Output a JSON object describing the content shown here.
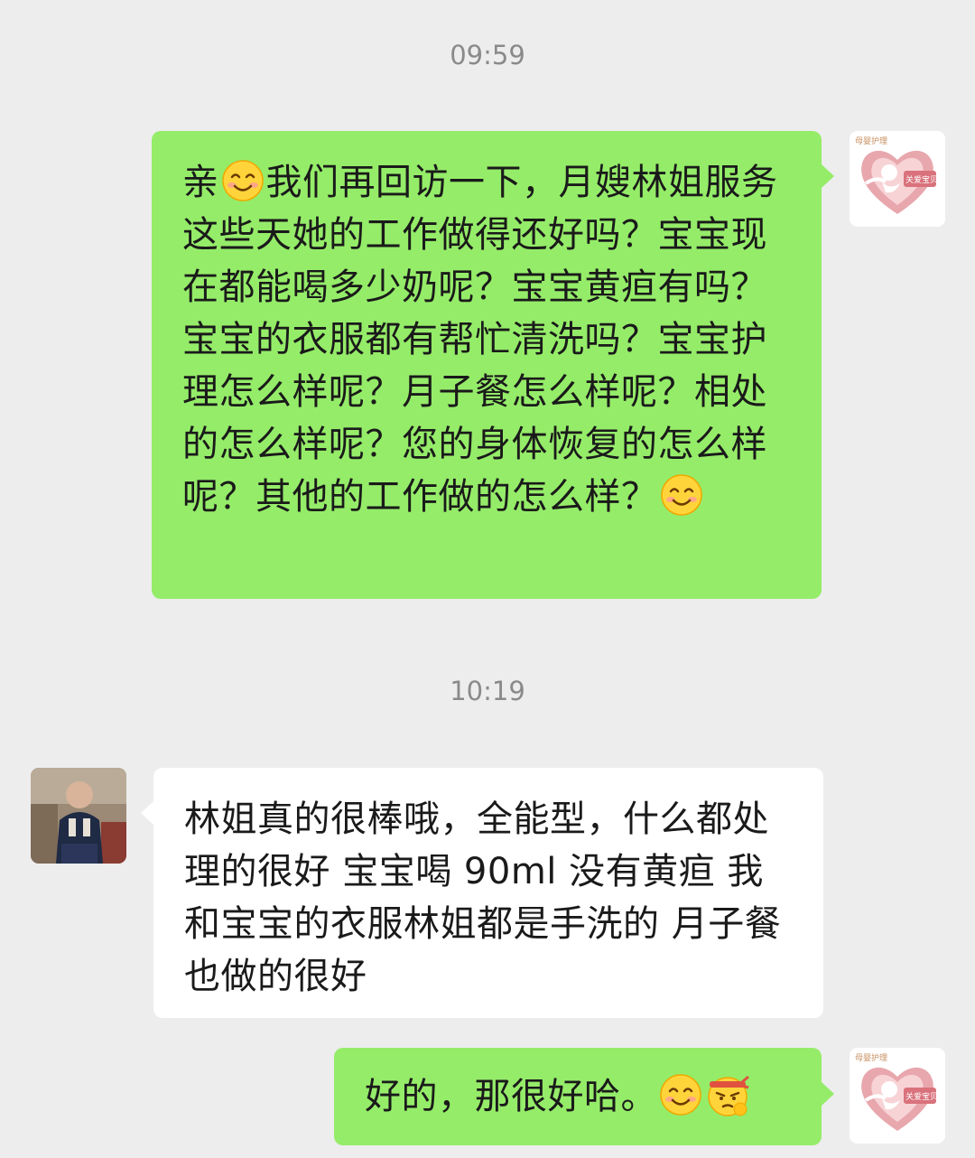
{
  "chat": {
    "timestamp_1": "09:59",
    "timestamp_2": "10:19",
    "msg1": {
      "part1": "亲",
      "part2": "我们再回访一下，月嫂林姐服务这些天她的工作做得还好吗？宝宝现在都能喝多少奶呢？宝宝黄疸有吗？宝宝的衣服都有帮忙清洗吗？宝宝护理怎么样呢？月子餐怎么样呢？相处的怎么样呢？您的身体恢复的怎么样呢？其他的工作做的怎么样？"
    },
    "msg2": {
      "text": "林姐真的很棒哦，全能型，什么都处理的很好 宝宝喝 90ml 没有黄疸 我和宝宝的衣服林姐都是手洗的 月子餐也做的很好"
    },
    "msg3": {
      "text": "好的，那很好哈。"
    },
    "avatar_me": {
      "brand_small": "母婴护理",
      "brand_badge": "关爱宝贝"
    }
  },
  "colors": {
    "background": "#ededed",
    "my_bubble": "#95ec69",
    "other_bubble": "#ffffff",
    "timestamp": "#8a8a8a",
    "heart": "#e8a7ad"
  },
  "icons": {
    "smile": "smiling-face-emoji",
    "cheer": "fighting-face-emoji"
  }
}
